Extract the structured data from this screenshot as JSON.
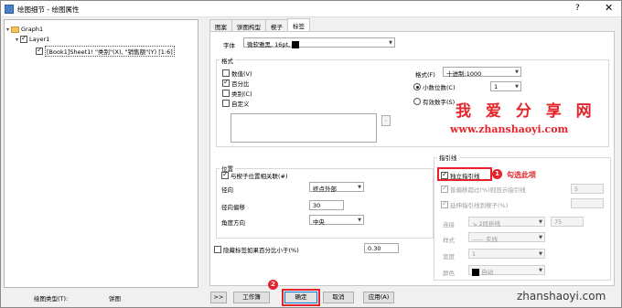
{
  "window": {
    "title": "绘图细节 - 绘图属性",
    "help": "?",
    "close": "✕"
  },
  "tree": {
    "graph": "Graph1",
    "layer": "Layer1",
    "plot": "[Book1]Sheet1! \"类别\"(X), \"销售额\"(Y) [1:6]"
  },
  "tabs": [
    "图案",
    "饼图构型",
    "楔子",
    "标签"
  ],
  "font": {
    "label": "字体",
    "value": "微软雅黑, 16pt,"
  },
  "format_group": {
    "title": "格式",
    "checks": [
      {
        "label": "数值(V)",
        "checked": false
      },
      {
        "label": "百分比",
        "checked": true
      },
      {
        "label": "类别(C)",
        "checked": false
      },
      {
        "label": "自定义",
        "checked": false
      }
    ],
    "format_label": "格式(F)",
    "format_value": "十进制:1000",
    "decimal_label": "小数位数(C)",
    "decimal_value": "1",
    "sigfig_label": "有效数字(S)"
  },
  "position_group": {
    "title": "位置",
    "link_label": "与楔子位置相关联(#)",
    "radial_label": "径向",
    "radial_value": "终点外部",
    "offset_label": "径向偏移",
    "offset_value": "30",
    "angle_label": "角度方向",
    "angle_value": "中央"
  },
  "hide_label": {
    "label": "隐藏标签如果百分比小于(%)",
    "value": "0.30"
  },
  "leader_group": {
    "title": "指引线",
    "independent_label": "独立指引线",
    "show_if_label": "普偏移超过(%)则显示指引线",
    "show_if_value": "5",
    "extend_label": "延伸指引线到楔子(%)",
    "extend_value": "75",
    "connect_label": "连接",
    "connect_value": "2段折线",
    "style_label": "样式",
    "style_value": "实线",
    "width_label": "宽度",
    "width_value": "1",
    "color_label": "颜色",
    "color_value": "自动"
  },
  "annotations": {
    "step1": "1",
    "step1_text": "勾选此项",
    "step2": "2",
    "site_cn": "我 爱 分 享 网",
    "site_url": "www.zhanshaoyi.com",
    "site_url2": "zhanshaoyi.com"
  },
  "footer": {
    "plot_type_label": "绘图类型(T):",
    "plot_type_value": "饼图",
    "expand": ">>",
    "workbook": "工作簿",
    "ok": "确定",
    "cancel": "取消",
    "apply": "应用(A)"
  },
  "colors": {
    "accent_red": "#e4242a"
  }
}
